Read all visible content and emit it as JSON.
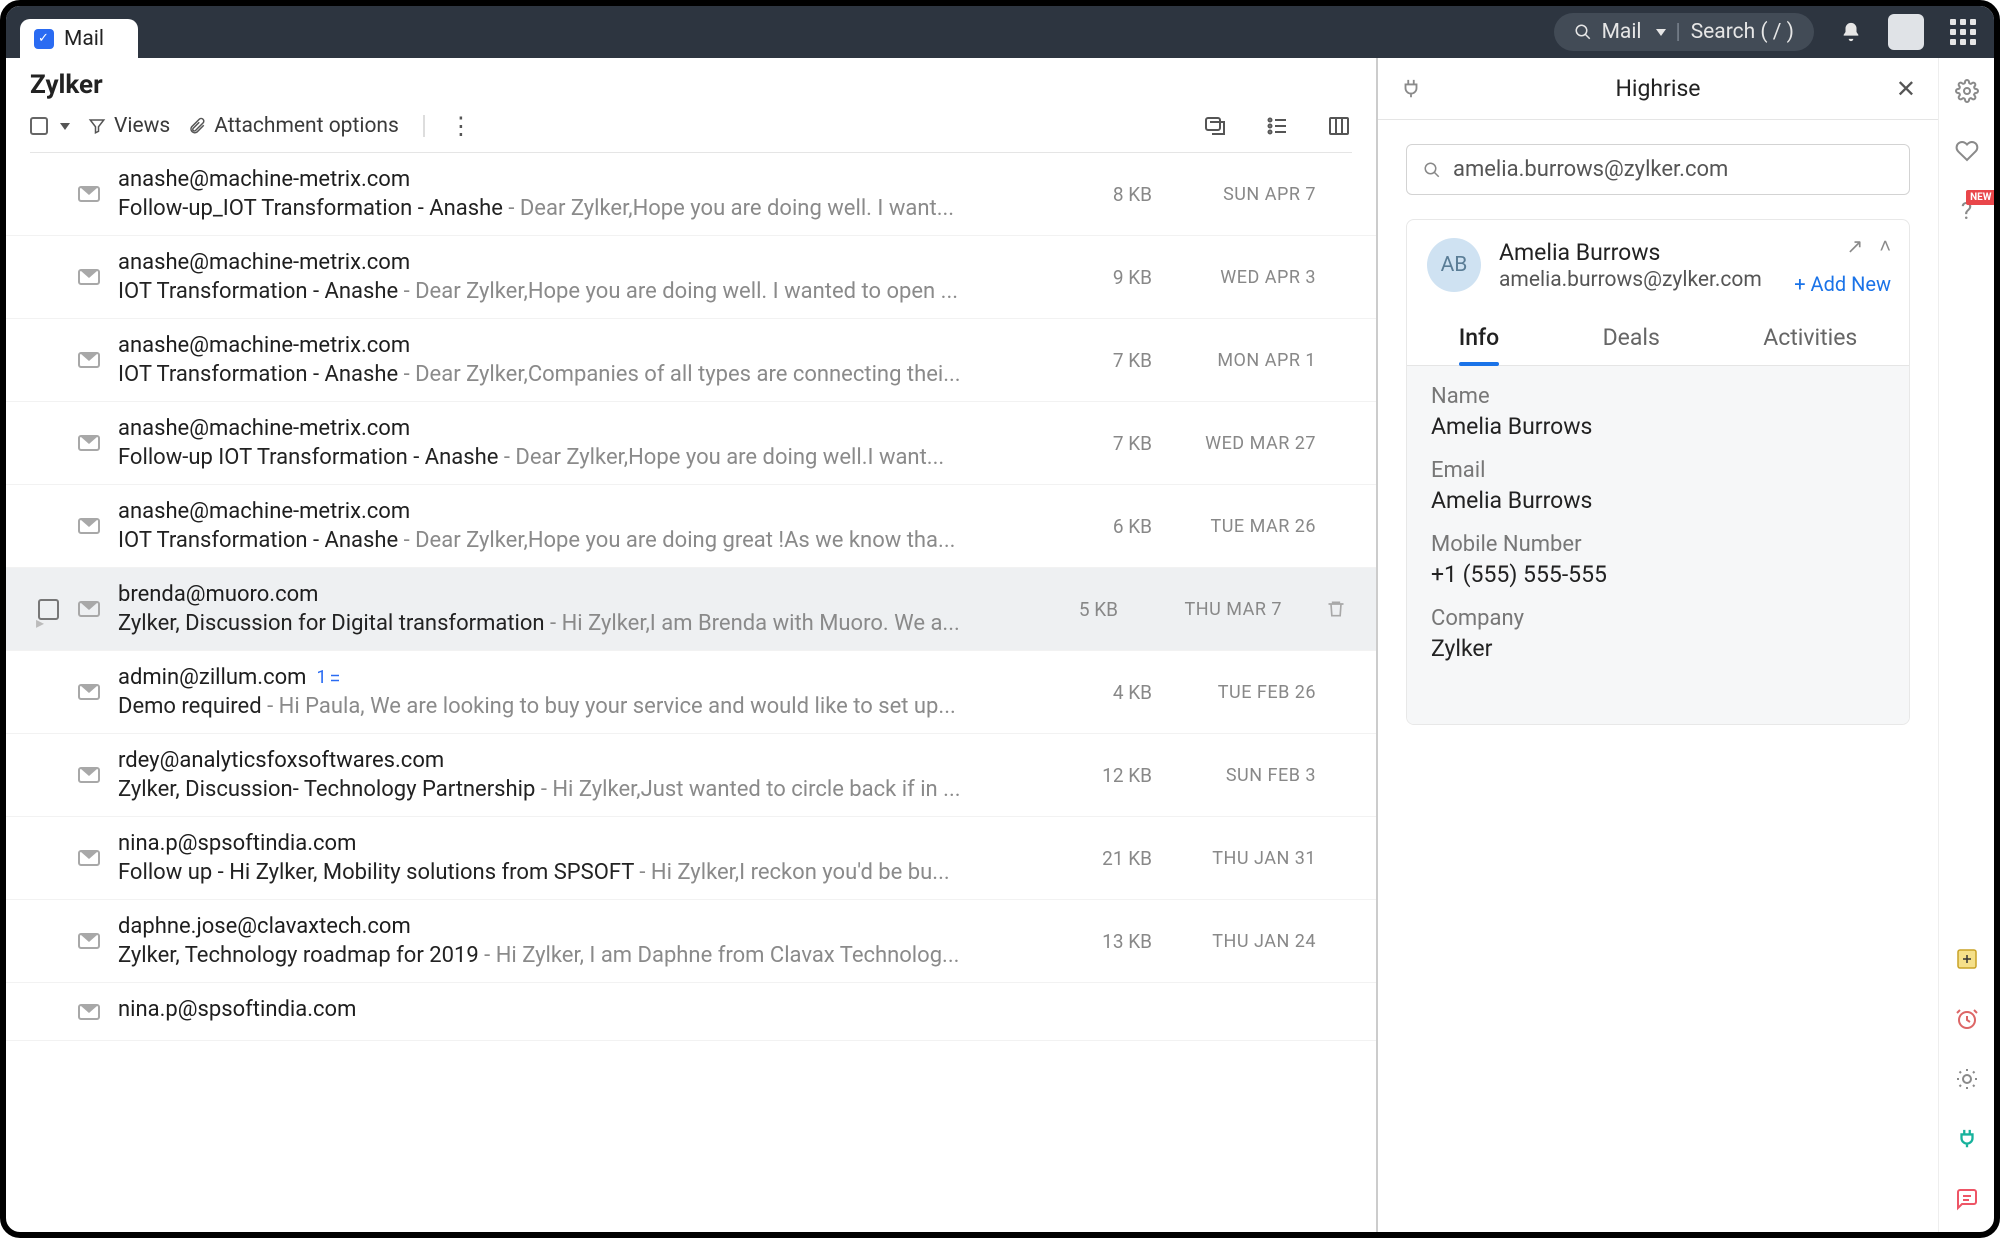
{
  "top": {
    "tab_label": "Mail",
    "search_scope": "Mail",
    "search_placeholder": "Search ( / )"
  },
  "mail": {
    "folder": "Zylker",
    "views_label": "Views",
    "attach_label": "Attachment options",
    "items": [
      {
        "from": "anashe@machine-metrix.com",
        "subject": "Follow-up_IOT Transformation - Anashe",
        "preview": " - Dear Zylker,Hope you are doing well. I want...",
        "size": "8 KB",
        "date": "SUN APR 7"
      },
      {
        "from": "anashe@machine-metrix.com",
        "subject": "IOT Transformation - Anashe",
        "preview": " - Dear Zylker,Hope you are doing well. I wanted to open ...",
        "size": "9 KB",
        "date": "WED APR 3"
      },
      {
        "from": "anashe@machine-metrix.com",
        "subject": "IOT Transformation - Anashe",
        "preview": " - Dear Zylker,Companies of all types are connecting thei...",
        "size": "7 KB",
        "date": "MON APR 1"
      },
      {
        "from": "anashe@machine-metrix.com",
        "subject": "Follow-up  IOT Transformation - Anashe",
        "preview": " - Dear Zylker,Hope you are doing well.I want...",
        "size": "7 KB",
        "date": "WED MAR 27"
      },
      {
        "from": "anashe@machine-metrix.com",
        "subject": "IOT Transformation - Anashe",
        "preview": " - Dear Zylker,Hope you are doing great !As we know tha...",
        "size": "6 KB",
        "date": "TUE MAR 26"
      },
      {
        "from": "brenda@muoro.com",
        "subject": "Zylker, Discussion for Digital transformation",
        "preview": " - Hi Zylker,I am Brenda with Muoro. We a...",
        "size": "5 KB",
        "date": "THU MAR 7",
        "selected": true
      },
      {
        "from": "admin@zillum.com",
        "thread": "1",
        "subject": "Demo required",
        "preview": " - Hi Paula, We are looking to buy your service and would like to set up...",
        "size": "4 KB",
        "date": "TUE FEB 26"
      },
      {
        "from": "rdey@analyticsfoxsoftwares.com",
        "subject": "Zylker, Discussion- Technology Partnership",
        "preview": " - Hi Zylker,Just wanted to circle back if in ...",
        "size": "12 KB",
        "date": "SUN FEB 3"
      },
      {
        "from": "nina.p@spsoftindia.com",
        "subject": "Follow up - Hi Zylker, Mobility solutions from SPSOFT",
        "preview": " - Hi Zylker,I reckon you'd be bu...",
        "size": "21 KB",
        "date": "THU JAN 31"
      },
      {
        "from": "daphne.jose@clavaxtech.com",
        "subject": "Zylker, Technology roadmap for 2019",
        "preview": " - Hi Zylker, I am Daphne from Clavax Technolog...",
        "size": "13 KB",
        "date": "THU JAN 24"
      },
      {
        "from": "nina.p@spsoftindia.com",
        "subject": "",
        "preview": "",
        "size": "",
        "date": ""
      }
    ]
  },
  "panel": {
    "title": "Highrise",
    "search_value": "amelia.burrows@zylker.com",
    "contact": {
      "initials": "AB",
      "name": "Amelia Burrows",
      "email": "amelia.burrows@zylker.com",
      "add_new": "+ Add New",
      "tabs": {
        "info": "Info",
        "deals": "Deals",
        "activities": "Activities"
      },
      "fields": {
        "name_label": "Name",
        "name_value": "Amelia Burrows",
        "email_label": "Email",
        "email_value": "Amelia Burrows",
        "mobile_label": "Mobile Number",
        "mobile_value": "+1 (555) 555-555",
        "company_label": "Company",
        "company_value": "Zylker"
      }
    }
  },
  "rail": {
    "new_badge": "NEW"
  }
}
